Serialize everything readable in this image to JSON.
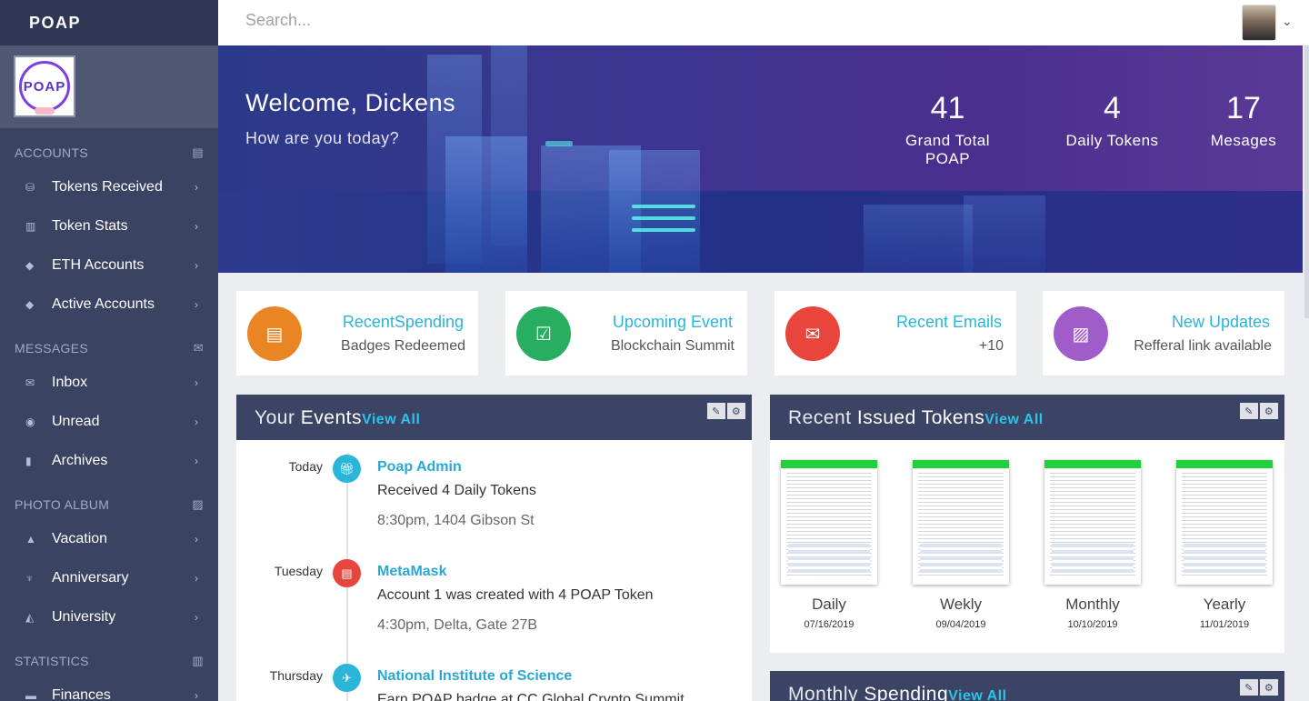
{
  "brand": {
    "name": "POAP",
    "logo_text": "POAP"
  },
  "search": {
    "placeholder": "Search..."
  },
  "sidebar": {
    "sections": [
      {
        "title": "ACCOUNTS",
        "icon": "clipboard-icon",
        "items": [
          {
            "label": "Tokens Received",
            "icon": "coins-icon"
          },
          {
            "label": "Token Stats",
            "icon": "bar-chart-icon"
          },
          {
            "label": "ETH Accounts",
            "icon": "ethereum-icon"
          },
          {
            "label": "Active Accounts",
            "icon": "ethereum-icon"
          }
        ]
      },
      {
        "title": "MESSAGES",
        "icon": "envelope-icon",
        "items": [
          {
            "label": "Inbox",
            "icon": "envelope-icon"
          },
          {
            "label": "Unread",
            "icon": "eye-icon"
          },
          {
            "label": "Archives",
            "icon": "book-icon"
          }
        ]
      },
      {
        "title": "PHOTO ALBUM",
        "icon": "image-icon",
        "items": [
          {
            "label": "Vacation",
            "icon": "mountain-icon"
          },
          {
            "label": "Anniversary",
            "icon": "glass-icon"
          },
          {
            "label": "University",
            "icon": "graduation-cap-icon"
          }
        ]
      },
      {
        "title": "STATISTICS",
        "icon": "bar-chart-icon",
        "items": [
          {
            "label": "Finances",
            "icon": "credit-card-icon"
          }
        ]
      }
    ]
  },
  "hero": {
    "greeting": "Welcome,",
    "user": "Dickens",
    "subtitle": "How are you today?",
    "stats": [
      {
        "value": "41",
        "label": "Grand Total POAP"
      },
      {
        "value": "4",
        "label": "Daily Tokens"
      },
      {
        "value": "17",
        "label": "Mesages"
      }
    ]
  },
  "info_cards": [
    {
      "title_a": "Recent",
      "title_b": "Spending",
      "sub": "Badges Redeemed",
      "color": "#ea8524",
      "icon": "document-icon"
    },
    {
      "title_a": "Upcoming ",
      "title_b": "Event",
      "sub": "Blockchain Summit",
      "color": "#27ae60",
      "icon": "calendar-check-icon"
    },
    {
      "title_a": "Recent ",
      "title_b": "Emails",
      "sub": "+10",
      "color": "#e8453c",
      "icon": "envelope-icon"
    },
    {
      "title_a": "New ",
      "title_b": "Updates",
      "sub": "Refferal link available",
      "color": "#a05cc8",
      "icon": "file-image-icon"
    }
  ],
  "events_panel": {
    "title_a": "Your ",
    "title_b": "Events",
    "view_all": "View All",
    "events": [
      {
        "day": "Today",
        "title": "Poap Admin",
        "desc": "Received 4 Daily Tokens",
        "meta": "8:30pm, 1404 Gibson St",
        "color": "#2bb5d8",
        "icon": "gift-icon"
      },
      {
        "day": "Tuesday",
        "title": "MetaMask",
        "desc": "Account 1 was created with 4 POAP Token",
        "meta": "4:30pm, Delta, Gate 27B",
        "color": "#e8453c",
        "icon": "book-icon"
      },
      {
        "day": "Thursday",
        "title": "National Institute of Science",
        "desc": "Earn POAP badge at CC Global Crypto Summit",
        "meta": "",
        "color": "#2bb5d8",
        "icon": "plane-icon"
      }
    ]
  },
  "tokens_panel": {
    "title_a": "Recent ",
    "title_b": "Issued Tokens",
    "view_all": "View All",
    "tokens": [
      {
        "label": "Daily",
        "date": "07/16/2019"
      },
      {
        "label": "Wekly",
        "date": "09/04/2019"
      },
      {
        "label": "Monthly",
        "date": "10/10/2019"
      },
      {
        "label": "Yearly",
        "date": "11/01/2019"
      }
    ]
  },
  "spending_panel": {
    "title_a": "Monthly ",
    "title_b": "Spending",
    "view_all": "View All"
  },
  "panel_tools": {
    "edit_icon": "edit-icon",
    "settings_icon": "gear-icon"
  }
}
